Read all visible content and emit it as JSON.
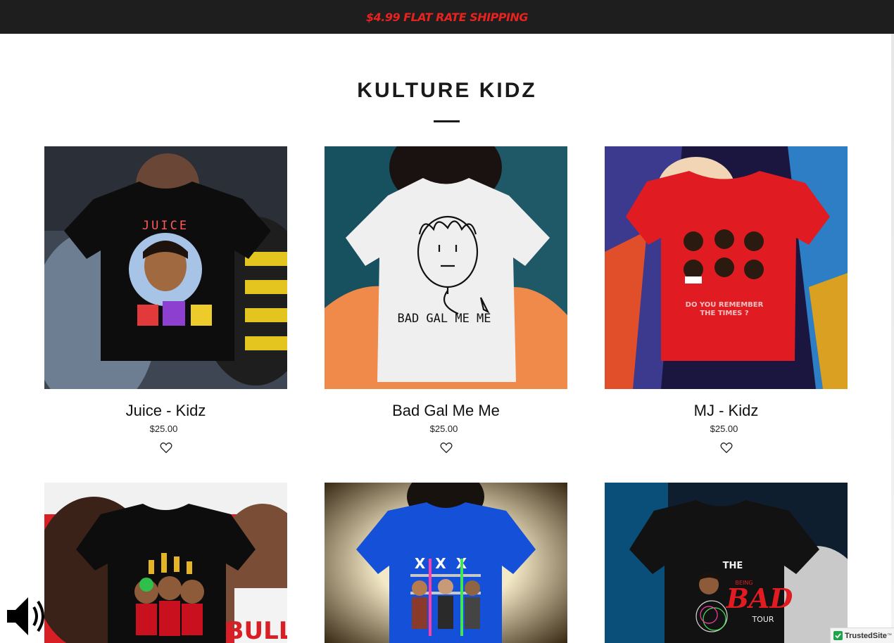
{
  "promo": {
    "text": "$4.99 FLAT RATE SHIPPING"
  },
  "collection": {
    "title": "KULTURE KIDZ"
  },
  "products": [
    {
      "name": "Juice - Kidz",
      "price": "$25.00",
      "shirt_color": "#0d0d0d",
      "print_text": "JUICE"
    },
    {
      "name": "Bad Gal Me Me",
      "price": "$25.00",
      "shirt_color": "#efefef",
      "print_text": "BAD GAL ME ME"
    },
    {
      "name": "MJ - Kidz",
      "price": "$25.00",
      "shirt_color": "#e11b22",
      "print_text": "DO YOU REMEMBER THE TIMES ?"
    },
    {
      "name": "",
      "price": "",
      "shirt_color": "#0d0d0d",
      "print_text": ""
    },
    {
      "name": "",
      "price": "",
      "shirt_color": "#1450d8",
      "print_text": "X X X"
    },
    {
      "name": "",
      "price": "",
      "shirt_color": "#121212",
      "print_text": "THE BEING BAD TOUR"
    }
  ],
  "icons": {
    "wishlist": "heart-outline-icon",
    "sound": "speaker-icon",
    "trust": "check-icon"
  },
  "badge": {
    "text": "TrustedSite",
    "tm": "™"
  }
}
